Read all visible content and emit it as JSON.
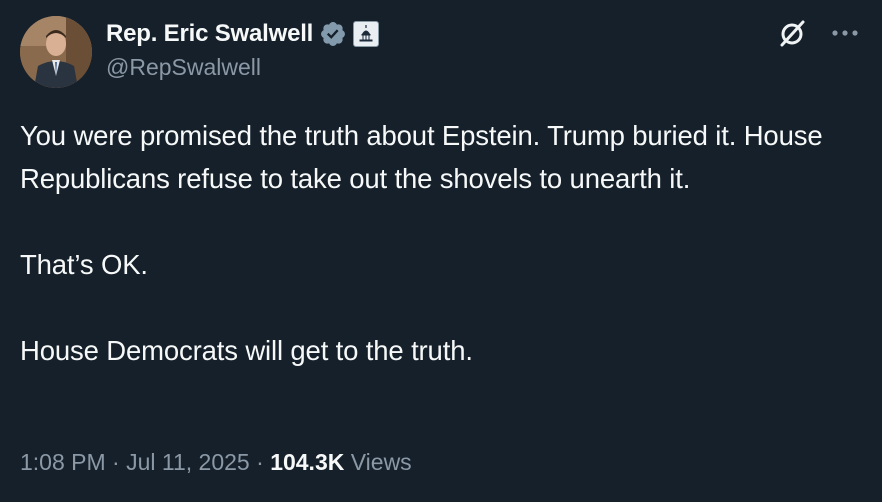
{
  "author": {
    "display_name": "Rep. Eric Swalwell",
    "handle": "@RepSwalwell",
    "avatar_icon": "avatar-photo",
    "verified_icon": "verified-badge-icon",
    "affiliation_icon": "capitol-dome-icon"
  },
  "header_actions": {
    "grok_icon": "grok-icon",
    "more_icon": "more-options-icon"
  },
  "post": {
    "paragraphs": [
      "You were promised the truth about Epstein. Trump buried it. House Republicans refuse to take out the shovels to unearth it.",
      "That’s OK.",
      "House Democrats will get to the truth."
    ]
  },
  "meta": {
    "time": "1:08 PM",
    "separator": " · ",
    "date": "Jul 11, 2025",
    "views_count": "104.3K",
    "views_label": "Views"
  },
  "colors": {
    "background": "#15202b",
    "text_primary": "#f7f9f9",
    "text_secondary": "#8b98a5",
    "verified_badge": "#829aab"
  }
}
